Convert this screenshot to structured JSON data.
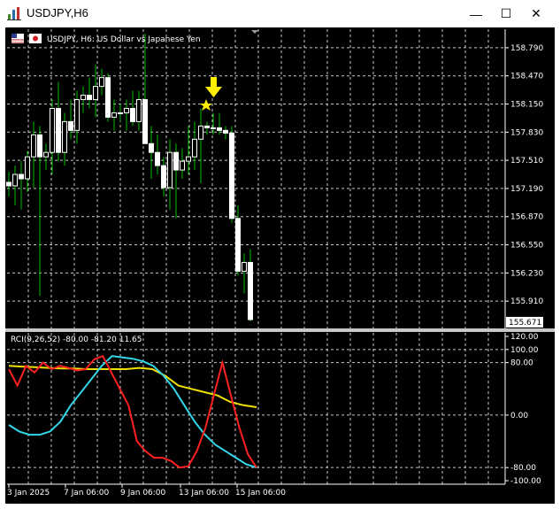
{
  "window": {
    "title": "USDJPY,H6",
    "minimize_glyph": "—",
    "maximize_glyph": "☐",
    "close_glyph": "✕"
  },
  "chart_header": {
    "text": "USDJPY, H6:  US Dollar vs Japanese Yen"
  },
  "indicator_header": {
    "text": "RCI(9,26,52) -80.00 -81.20 11.65"
  },
  "price_axis": {
    "labels": [
      "158.790",
      "158.470",
      "158.150",
      "157.830",
      "157.510",
      "157.190",
      "156.870",
      "156.550",
      "156.230",
      "155.910"
    ],
    "current": "155.671"
  },
  "rci_axis": {
    "labels": [
      "120.00",
      "100.00",
      "80.00",
      "0.00",
      "-80.00",
      "-100.00"
    ]
  },
  "time_axis": {
    "labels": [
      "3 Jan 2025",
      "7 Jan 06:00",
      "9 Jan 06:00",
      "13 Jan 06:00",
      "15 Jan 06:00"
    ]
  },
  "colors": {
    "background": "#000000",
    "bull": "#ffffff",
    "bear": "#ffffff",
    "wick": "#00c000",
    "rci_short": "#ff2020",
    "rci_mid": "#33d6e8",
    "rci_long": "#f0e000",
    "arrow": "#ffee00",
    "star": "#ffee00"
  },
  "chart_data": {
    "type": "candlestick",
    "symbol": "USDJPY",
    "timeframe": "H6",
    "ylim": [
      155.6,
      159.0
    ],
    "candles": [
      {
        "o": 157.26,
        "h": 157.38,
        "l": 157.1,
        "c": 157.22
      },
      {
        "o": 157.22,
        "h": 157.45,
        "l": 157.0,
        "c": 157.35
      },
      {
        "o": 157.35,
        "h": 157.5,
        "l": 156.95,
        "c": 157.3
      },
      {
        "o": 157.3,
        "h": 157.62,
        "l": 157.15,
        "c": 157.55
      },
      {
        "o": 157.55,
        "h": 157.95,
        "l": 157.2,
        "c": 157.8
      },
      {
        "o": 157.8,
        "h": 157.9,
        "l": 155.97,
        "c": 157.55
      },
      {
        "o": 157.55,
        "h": 157.7,
        "l": 157.4,
        "c": 157.6
      },
      {
        "o": 157.6,
        "h": 158.2,
        "l": 157.35,
        "c": 158.1
      },
      {
        "o": 158.1,
        "h": 158.4,
        "l": 157.5,
        "c": 157.6
      },
      {
        "o": 157.6,
        "h": 158.05,
        "l": 157.45,
        "c": 157.95
      },
      {
        "o": 157.95,
        "h": 158.2,
        "l": 157.75,
        "c": 157.85
      },
      {
        "o": 157.85,
        "h": 158.3,
        "l": 157.7,
        "c": 158.2
      },
      {
        "o": 158.2,
        "h": 158.35,
        "l": 158.05,
        "c": 158.25
      },
      {
        "o": 158.25,
        "h": 158.45,
        "l": 158.1,
        "c": 158.2
      },
      {
        "o": 158.2,
        "h": 158.6,
        "l": 158.0,
        "c": 158.35
      },
      {
        "o": 158.35,
        "h": 158.55,
        "l": 158.25,
        "c": 158.45
      },
      {
        "o": 158.45,
        "h": 158.5,
        "l": 157.95,
        "c": 158.0
      },
      {
        "o": 158.0,
        "h": 158.2,
        "l": 157.85,
        "c": 158.05
      },
      {
        "o": 158.05,
        "h": 158.15,
        "l": 157.95,
        "c": 158.05
      },
      {
        "o": 158.05,
        "h": 158.2,
        "l": 157.85,
        "c": 158.1
      },
      {
        "o": 158.1,
        "h": 158.3,
        "l": 157.9,
        "c": 157.95
      },
      {
        "o": 157.95,
        "h": 158.3,
        "l": 157.85,
        "c": 158.2
      },
      {
        "o": 158.2,
        "h": 158.95,
        "l": 157.7,
        "c": 157.7
      },
      {
        "o": 157.7,
        "h": 157.9,
        "l": 157.3,
        "c": 157.6
      },
      {
        "o": 157.6,
        "h": 157.8,
        "l": 157.35,
        "c": 157.45
      },
      {
        "o": 157.45,
        "h": 157.55,
        "l": 157.1,
        "c": 157.2
      },
      {
        "o": 157.2,
        "h": 157.75,
        "l": 156.95,
        "c": 157.6
      },
      {
        "o": 157.6,
        "h": 157.7,
        "l": 156.85,
        "c": 157.4
      },
      {
        "o": 157.4,
        "h": 157.65,
        "l": 157.3,
        "c": 157.5
      },
      {
        "o": 157.5,
        "h": 157.9,
        "l": 157.35,
        "c": 157.55
      },
      {
        "o": 157.55,
        "h": 157.95,
        "l": 157.4,
        "c": 157.75
      },
      {
        "o": 157.75,
        "h": 158.1,
        "l": 157.25,
        "c": 157.9
      },
      {
        "o": 157.9,
        "h": 157.95,
        "l": 157.8,
        "c": 157.88
      },
      {
        "o": 157.88,
        "h": 158.05,
        "l": 157.8,
        "c": 157.88
      },
      {
        "o": 157.88,
        "h": 158.05,
        "l": 157.8,
        "c": 157.85
      },
      {
        "o": 157.85,
        "h": 157.9,
        "l": 157.75,
        "c": 157.82
      },
      {
        "o": 157.82,
        "h": 157.9,
        "l": 156.8,
        "c": 156.85
      },
      {
        "o": 156.85,
        "h": 157.0,
        "l": 156.2,
        "c": 156.25
      },
      {
        "o": 156.25,
        "h": 156.45,
        "l": 156.0,
        "c": 156.35
      },
      {
        "o": 156.35,
        "h": 156.5,
        "l": 155.68,
        "c": 155.7
      }
    ],
    "indicator": {
      "name": "RCI",
      "params": [
        9,
        26,
        52
      ],
      "ylim": [
        -100,
        120
      ],
      "series": [
        {
          "values": [
            70,
            45,
            75,
            65,
            80,
            70,
            75,
            72,
            68,
            70,
            85,
            90,
            65,
            40,
            15,
            -40,
            -55,
            -65,
            -65,
            -70,
            -80,
            -78,
            -55,
            -20,
            30,
            80,
            30,
            -20,
            -60,
            -80
          ]
        },
        {
          "values": [
            -15,
            -25,
            -30,
            -30,
            -25,
            -10,
            15,
            35,
            55,
            75,
            90,
            88,
            86,
            82,
            75,
            60,
            40,
            15,
            -10,
            -30,
            -45,
            -55,
            -65,
            -75,
            -80
          ]
        },
        {
          "values": [
            75,
            74,
            73,
            72,
            71,
            71,
            70,
            70,
            70,
            70,
            72,
            70,
            60,
            45,
            40,
            35,
            30,
            20,
            15,
            12
          ]
        }
      ]
    }
  }
}
